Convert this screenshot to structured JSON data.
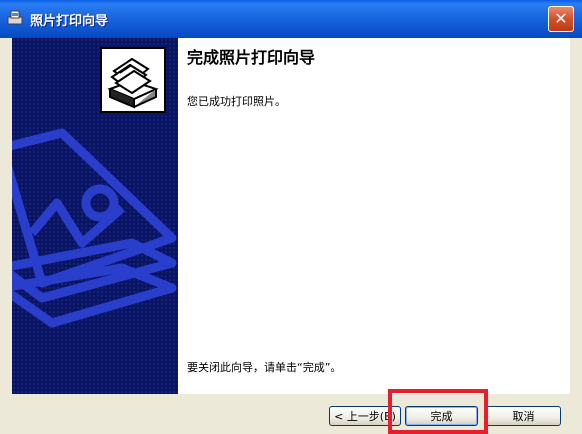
{
  "window": {
    "title": "照片打印向导",
    "close_glyph": "✕"
  },
  "content": {
    "heading": "完成照片打印向导",
    "message": "您已成功打印照片。",
    "footer_message": "要关闭此向导，请单击“完成”。"
  },
  "buttons": {
    "back_label": "< 上一步(B)",
    "finish_label": "完成",
    "cancel_label": "取消"
  },
  "colors": {
    "titlebar": "#0a5ee6",
    "left_panel": "#0a1464",
    "art_line": "#2a3ecc",
    "highlight": "#e61e2e"
  }
}
